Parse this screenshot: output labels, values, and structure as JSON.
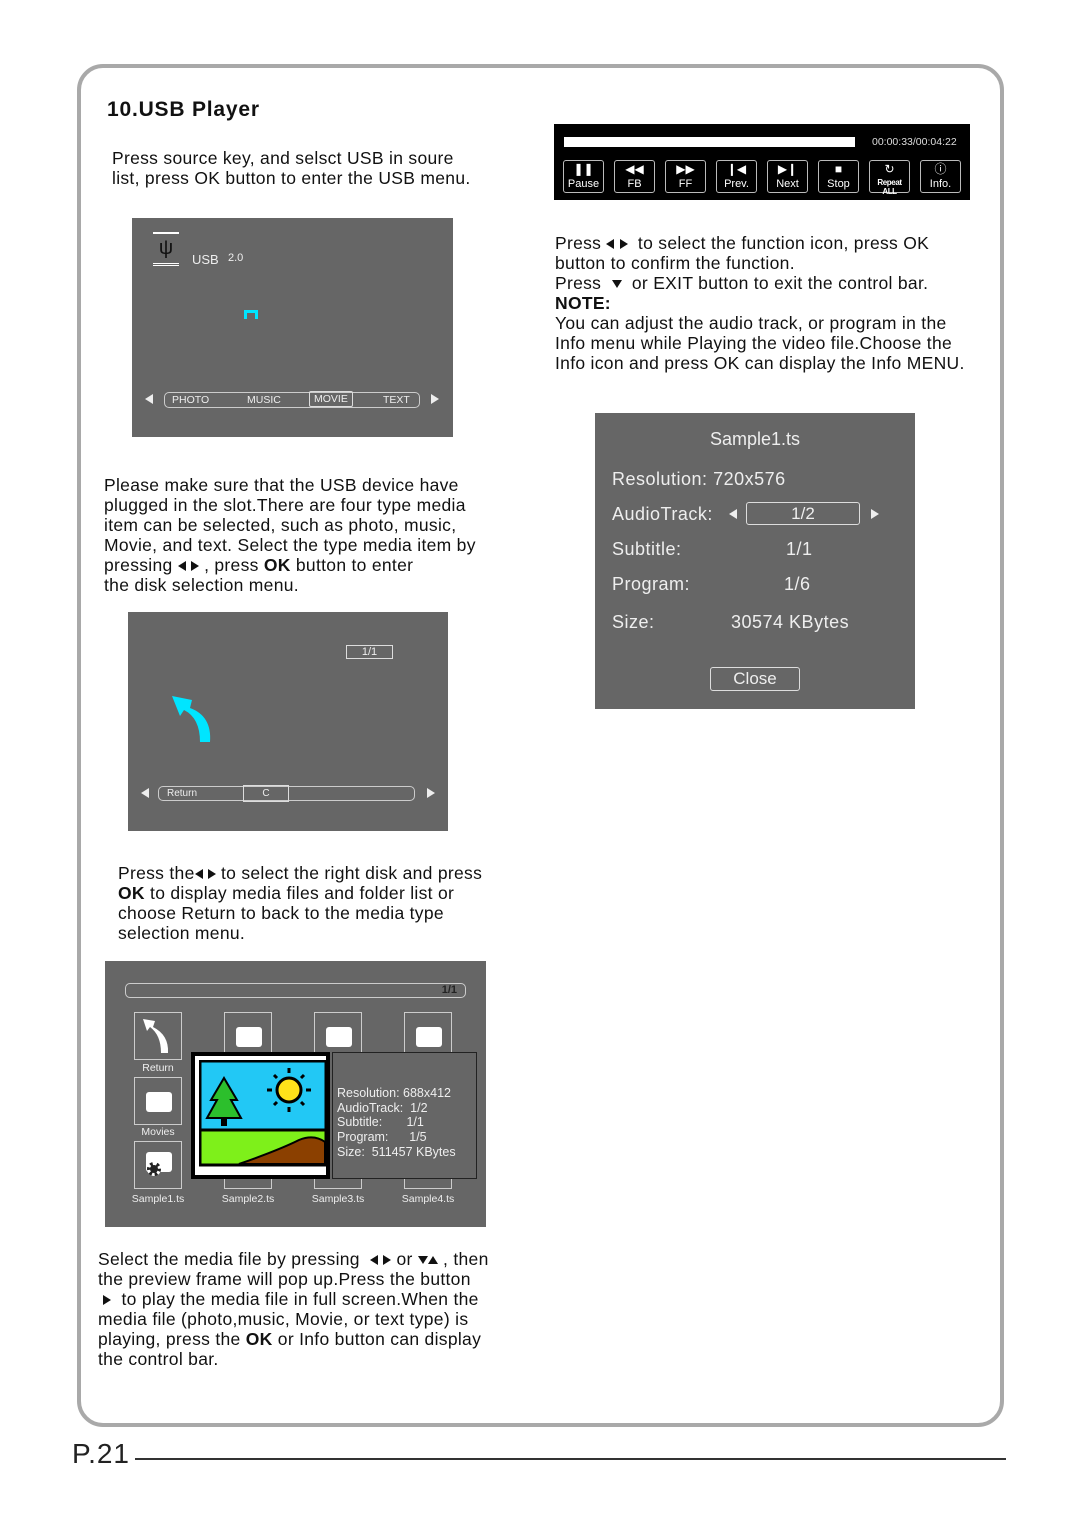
{
  "section_title": "10.USB Player",
  "intro": [
    "Press source key, and selsct USB in soure",
    "list, press OK button to enter the USB menu."
  ],
  "usb_menu": {
    "label": "USB",
    "version": "2.0",
    "tabs": [
      "PHOTO",
      "MUSIC",
      "MOVIE",
      "TEXT"
    ],
    "selected": "MOVIE",
    "icon_color": "#00e5ff"
  },
  "para2": {
    "lines": [
      "Please make sure that the USB device have",
      "plugged in the slot.There are four type media",
      "item can be selected, such as photo, music,",
      "Movie, and text. Select the type media item by"
    ],
    "pressing": "pressing",
    "press": ", press",
    "ok": "OK",
    "button_enter": "button to enter",
    "last": "the disk selection menu."
  },
  "disk_menu": {
    "page": "1/1",
    "return_label": "Return",
    "disk": "C"
  },
  "para3": {
    "press_the": "Press the",
    "rest1": "to select the right disk and press",
    "ok": "OK",
    "rest2": "to display media files and folder list or",
    "line3": "choose Return to back to the media type",
    "line4": "selection menu."
  },
  "browser": {
    "page": "1/1",
    "items": [
      "Return",
      "Movies",
      "Sample1.ts",
      "Sample2.ts",
      "Sample3.ts",
      "Sample4.ts"
    ],
    "preview_info": [
      "Resolution: 688x412",
      "AudioTrack:  1/2",
      "Subtitle:       1/1",
      "Program:      1/5",
      "Size:  511457 KBytes"
    ]
  },
  "para4": {
    "a": "Select the media file by pressing",
    "or": "or",
    ",then": ", then",
    "line2": "the preview frame will pop up.Press the button",
    "line3": "to play the media file in full screen.When the",
    "line4": "media file (photo,music, Movie, or text type) is",
    "line5a": "playing, press the",
    "ok": "OK",
    "line5b": "or Info button can display",
    "line6": "the control bar."
  },
  "control_bar": {
    "time": "00:00:33/00:04:22",
    "progress_percent": 100,
    "buttons": [
      "Pause",
      "FB",
      "FF",
      "Prev.",
      "Next",
      "Stop",
      "Repeat ALL",
      "Info."
    ]
  },
  "para5": {
    "press": "Press",
    "l1": "to select the function icon, press OK",
    "l2": "button to confirm the function.",
    "l3": "or EXIT button to exit the control bar.",
    "note": "NOTE:",
    "l4": "You can adjust the audio track, or program in the",
    "l5": "Info menu while Playing the video file.Choose the",
    "l6": "Info icon and press OK can display the Info MENU."
  },
  "info_menu": {
    "title": "Sample1.ts",
    "resolution_label": "Resolution:",
    "resolution": "720x576",
    "audio_label": "AudioTrack:",
    "audio": "1/2",
    "subtitle_label": "Subtitle:",
    "subtitle": "1/1",
    "program_label": "Program:",
    "program": "1/6",
    "size_label": "Size:",
    "size": "30574 KBytes",
    "close": "Close"
  },
  "page_number": "P.21"
}
